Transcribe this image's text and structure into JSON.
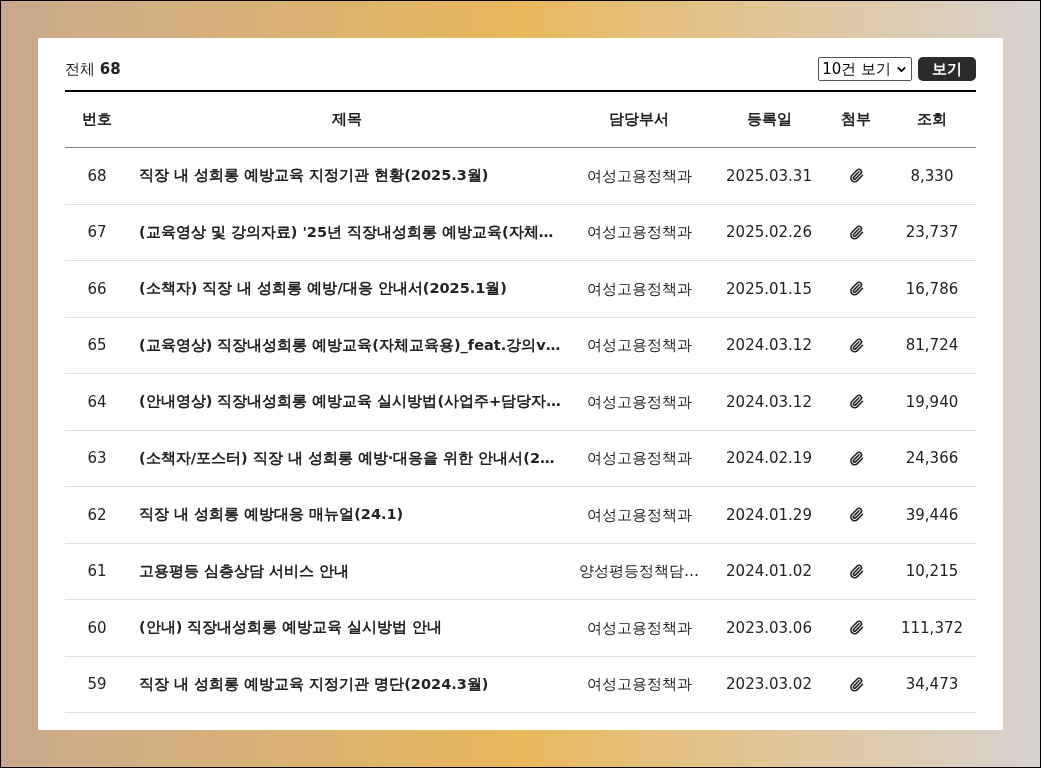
{
  "summary": {
    "label": "전체",
    "count": "68"
  },
  "page_size": {
    "value": "10건 보기"
  },
  "view_button": "보기",
  "table": {
    "columns": [
      "번호",
      "제목",
      "담당부서",
      "등록일",
      "첨부",
      "조회"
    ],
    "rows": [
      {
        "no": "68",
        "title": "직장 내 성희롱 예방교육 지정기관 현황(2025.3월)",
        "dept": "여성고용정책과",
        "date": "2025.03.31",
        "attached": true,
        "views": "8,330"
      },
      {
        "no": "67",
        "title": "(교육영상 및 강의자료) '25년 직장내성희롱 예방교육(자체…",
        "dept": "여성고용정책과",
        "date": "2025.02.26",
        "attached": true,
        "views": "23,737"
      },
      {
        "no": "66",
        "title": "(소책자) 직장 내 성희롱 예방/대응 안내서(2025.1월)",
        "dept": "여성고용정책과",
        "date": "2025.01.15",
        "attached": true,
        "views": "16,786"
      },
      {
        "no": "65",
        "title": "(교육영상) 직장내성희롱 예방교육(자체교육용)_feat.강의v…",
        "dept": "여성고용정책과",
        "date": "2024.03.12",
        "attached": true,
        "views": "81,724"
      },
      {
        "no": "64",
        "title": "(안내영상) 직장내성희롱 예방교육 실시방법(사업주+담당자…",
        "dept": "여성고용정책과",
        "date": "2024.03.12",
        "attached": true,
        "views": "19,940"
      },
      {
        "no": "63",
        "title": "(소책자/포스터) 직장 내 성희롱 예방·대응을 위한 안내서(2…",
        "dept": "여성고용정책과",
        "date": "2024.02.19",
        "attached": true,
        "views": "24,366"
      },
      {
        "no": "62",
        "title": "직장 내 성희롱 예방대응 매뉴얼(24.1)",
        "dept": "여성고용정책과",
        "date": "2024.01.29",
        "attached": true,
        "views": "39,446"
      },
      {
        "no": "61",
        "title": "고용평등 심층상담 서비스 안내",
        "dept": "양성평등정책담…",
        "date": "2024.01.02",
        "attached": true,
        "views": "10,215"
      },
      {
        "no": "60",
        "title": "(안내) 직장내성희롱 예방교육 실시방법 안내",
        "dept": "여성고용정책과",
        "date": "2023.03.06",
        "attached": true,
        "views": "111,372"
      },
      {
        "no": "59",
        "title": "직장 내 성희롱 예방교육 지정기관 명단(2024.3월)",
        "dept": "여성고용정책과",
        "date": "2023.03.02",
        "attached": true,
        "views": "34,473"
      }
    ]
  }
}
